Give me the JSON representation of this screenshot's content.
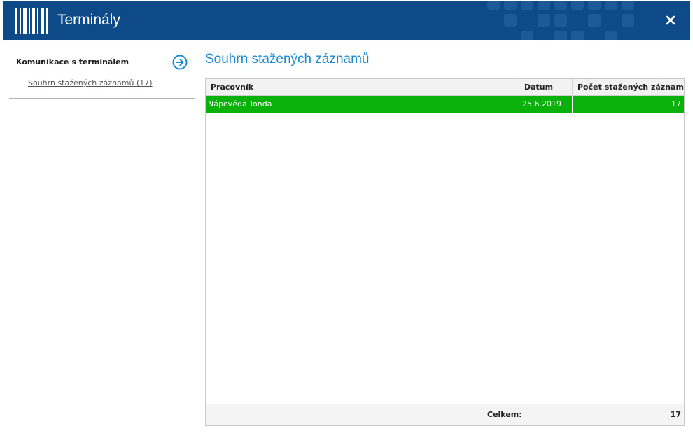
{
  "window": {
    "title": "Terminály",
    "icon": "barcode-icon",
    "close_icon": "close-icon"
  },
  "colors": {
    "titlebar": "#0d4a87",
    "accent": "#1a8ad4",
    "row_selected": "#0ab10a"
  },
  "sidebar": {
    "section_title": "Komunikace s terminálem",
    "arrow_icon": "arrow-right-circle-icon",
    "items": [
      {
        "label": "Souhrn stažených záznamů (17)"
      }
    ]
  },
  "main": {
    "title": "Souhrn stažených záznamů",
    "table": {
      "columns": [
        "Pracovník",
        "Datum",
        "Počet stažených záznamů"
      ],
      "rows": [
        [
          "Nápověda Tonda",
          "25.6.2019",
          "17"
        ]
      ],
      "footer": {
        "label": "Celkem:",
        "value": "17"
      }
    }
  }
}
